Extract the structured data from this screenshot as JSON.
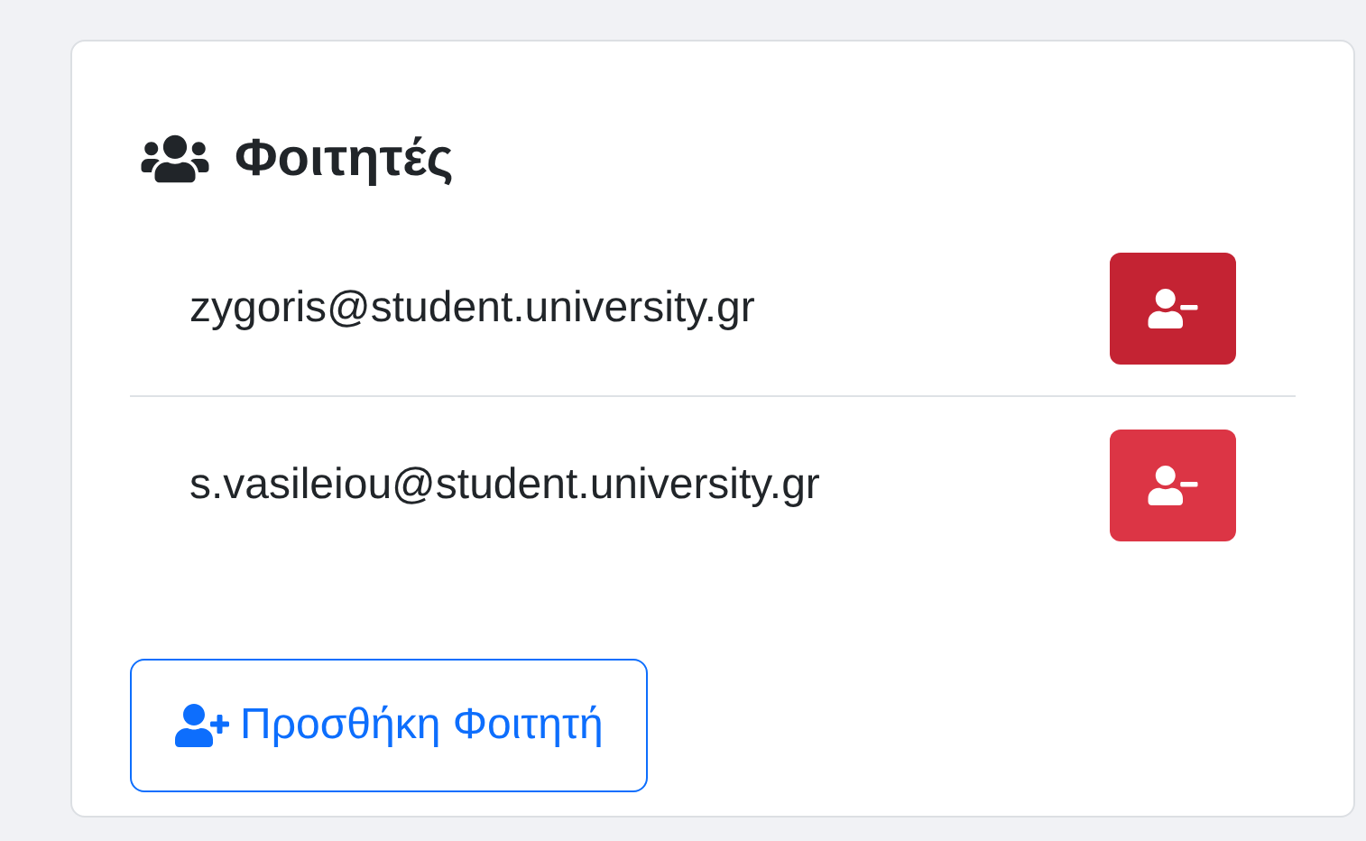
{
  "card": {
    "title": "Φοιτητές"
  },
  "students": [
    {
      "email": "zygoris@student.university.gr",
      "hovered": true
    },
    {
      "email": "s.vasileiou@student.university.gr",
      "hovered": false
    }
  ],
  "add_button": {
    "label": "Προσθήκη Φοιτητή"
  }
}
